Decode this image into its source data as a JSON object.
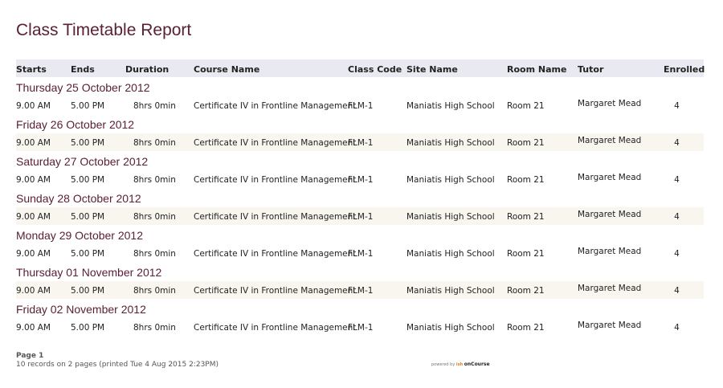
{
  "report": {
    "title": "Class Timetable Report"
  },
  "columns": {
    "starts": "Starts",
    "ends": "Ends",
    "duration": "Duration",
    "course": "Course Name",
    "code": "Class Code",
    "site": "Site Name",
    "room": "Room Name",
    "tutor": "Tutor",
    "enrolled": "Enrolled"
  },
  "groups": [
    {
      "date": "Thursday 25 October 2012",
      "row": {
        "starts": "9.00 AM",
        "ends": "5.00 PM",
        "duration": "8hrs  0min",
        "course": "Certificate IV in Frontline Management",
        "code": "FLM-1",
        "site": "Maniatis High School",
        "room": "Room 21",
        "tutor": "Margaret Mead",
        "enrolled": "4"
      }
    },
    {
      "date": "Friday 26 October 2012",
      "row": {
        "starts": "9.00 AM",
        "ends": "5.00 PM",
        "duration": "8hrs  0min",
        "course": "Certificate IV in Frontline Management",
        "code": "FLM-1",
        "site": "Maniatis High School",
        "room": "Room 21",
        "tutor": "Margaret Mead",
        "enrolled": "4"
      }
    },
    {
      "date": "Saturday 27 October 2012",
      "row": {
        "starts": "9.00 AM",
        "ends": "5.00 PM",
        "duration": "8hrs  0min",
        "course": "Certificate IV in Frontline Management",
        "code": "FLM-1",
        "site": "Maniatis High School",
        "room": "Room 21",
        "tutor": "Margaret Mead",
        "enrolled": "4"
      }
    },
    {
      "date": "Sunday 28 October 2012",
      "row": {
        "starts": "9.00 AM",
        "ends": "5.00 PM",
        "duration": "8hrs  0min",
        "course": "Certificate IV in Frontline Management",
        "code": "FLM-1",
        "site": "Maniatis High School",
        "room": "Room 21",
        "tutor": "Margaret Mead",
        "enrolled": "4"
      }
    },
    {
      "date": "Monday 29 October 2012",
      "row": {
        "starts": "9.00 AM",
        "ends": "5.00 PM",
        "duration": "8hrs  0min",
        "course": "Certificate IV in Frontline Management",
        "code": "FLM-1",
        "site": "Maniatis High School",
        "room": "Room 21",
        "tutor": "Margaret Mead",
        "enrolled": "4"
      }
    },
    {
      "date": "Thursday 01 November 2012",
      "row": {
        "starts": "9.00 AM",
        "ends": "5.00 PM",
        "duration": "8hrs  0min",
        "course": "Certificate IV in Frontline Management",
        "code": "FLM-1",
        "site": "Maniatis High School",
        "room": "Room 21",
        "tutor": "Margaret Mead",
        "enrolled": "4"
      }
    },
    {
      "date": "Friday 02 November 2012",
      "row": {
        "starts": "9.00 AM",
        "ends": "5.00 PM",
        "duration": "8hrs  0min",
        "course": "Certificate IV in Frontline Management",
        "code": "FLM-1",
        "site": "Maniatis High School",
        "room": "Room 21",
        "tutor": "Margaret Mead",
        "enrolled": "4"
      }
    }
  ],
  "footer": {
    "page": "Page 1",
    "records": "10 records on 2 pages (printed Tue 4 Aug 2015 2:23PM)"
  },
  "powered": {
    "text": "powered by",
    "mark": "ish",
    "brand": "onCourse"
  },
  "colors": {
    "accent": "#5b2035",
    "header_bg": "#e9e9f1",
    "alt_row_bg": "#f8f6ee"
  }
}
